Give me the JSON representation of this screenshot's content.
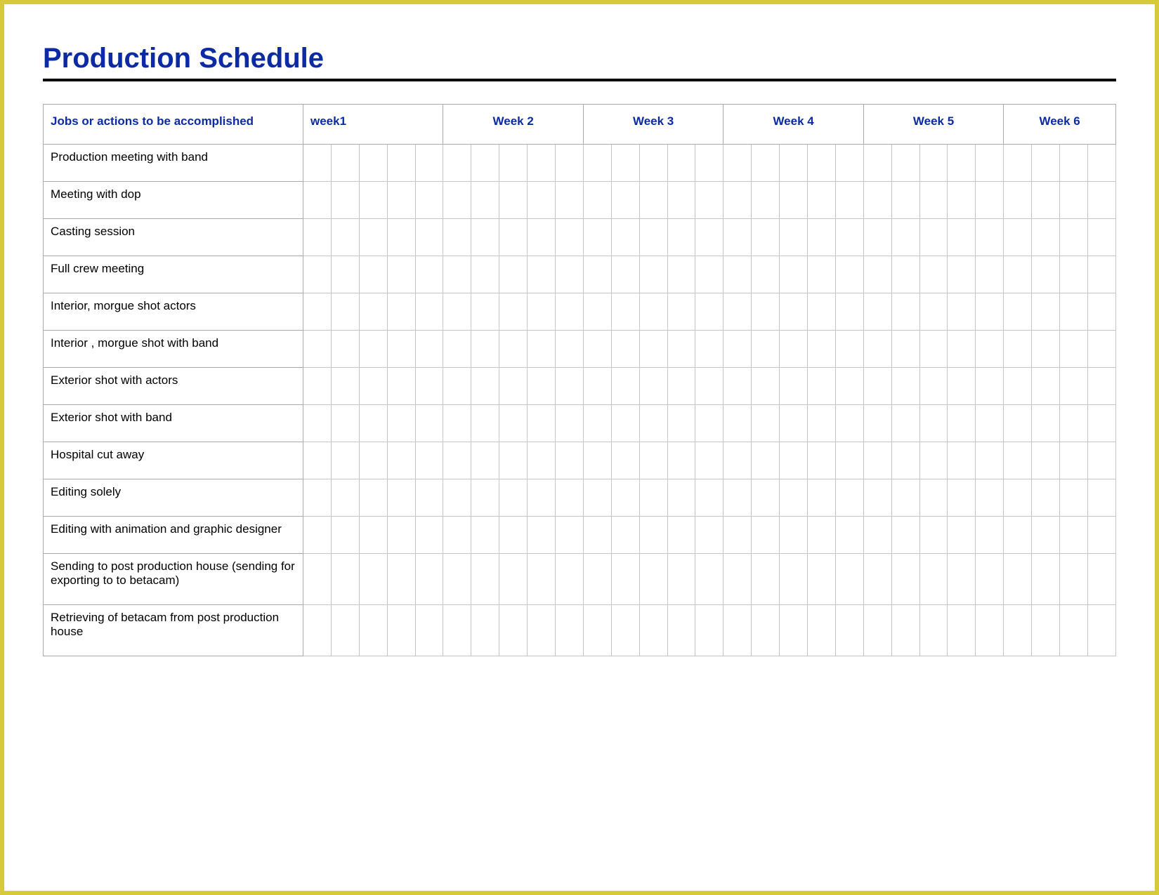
{
  "title": "Production Schedule",
  "columns": {
    "jobs": "Jobs or actions to be accomplished",
    "weeks": [
      "week1",
      "Week 2",
      "Week 3",
      "Week 4",
      "Week 5",
      "Week 6"
    ]
  },
  "sub_per_week": [
    5,
    5,
    5,
    5,
    5,
    4
  ],
  "rows": [
    "Production meeting with band",
    "Meeting with  dop",
    "Casting session",
    "Full crew meeting",
    "Interior, morgue shot actors",
    "Interior , morgue shot with band",
    "Exterior shot with actors",
    "Exterior shot with band",
    "Hospital cut away",
    "Editing solely",
    "Editing with animation and graphic designer",
    "Sending to  post production house (sending for exporting to to betacam)",
    "Retrieving of betacam  from post production house"
  ]
}
